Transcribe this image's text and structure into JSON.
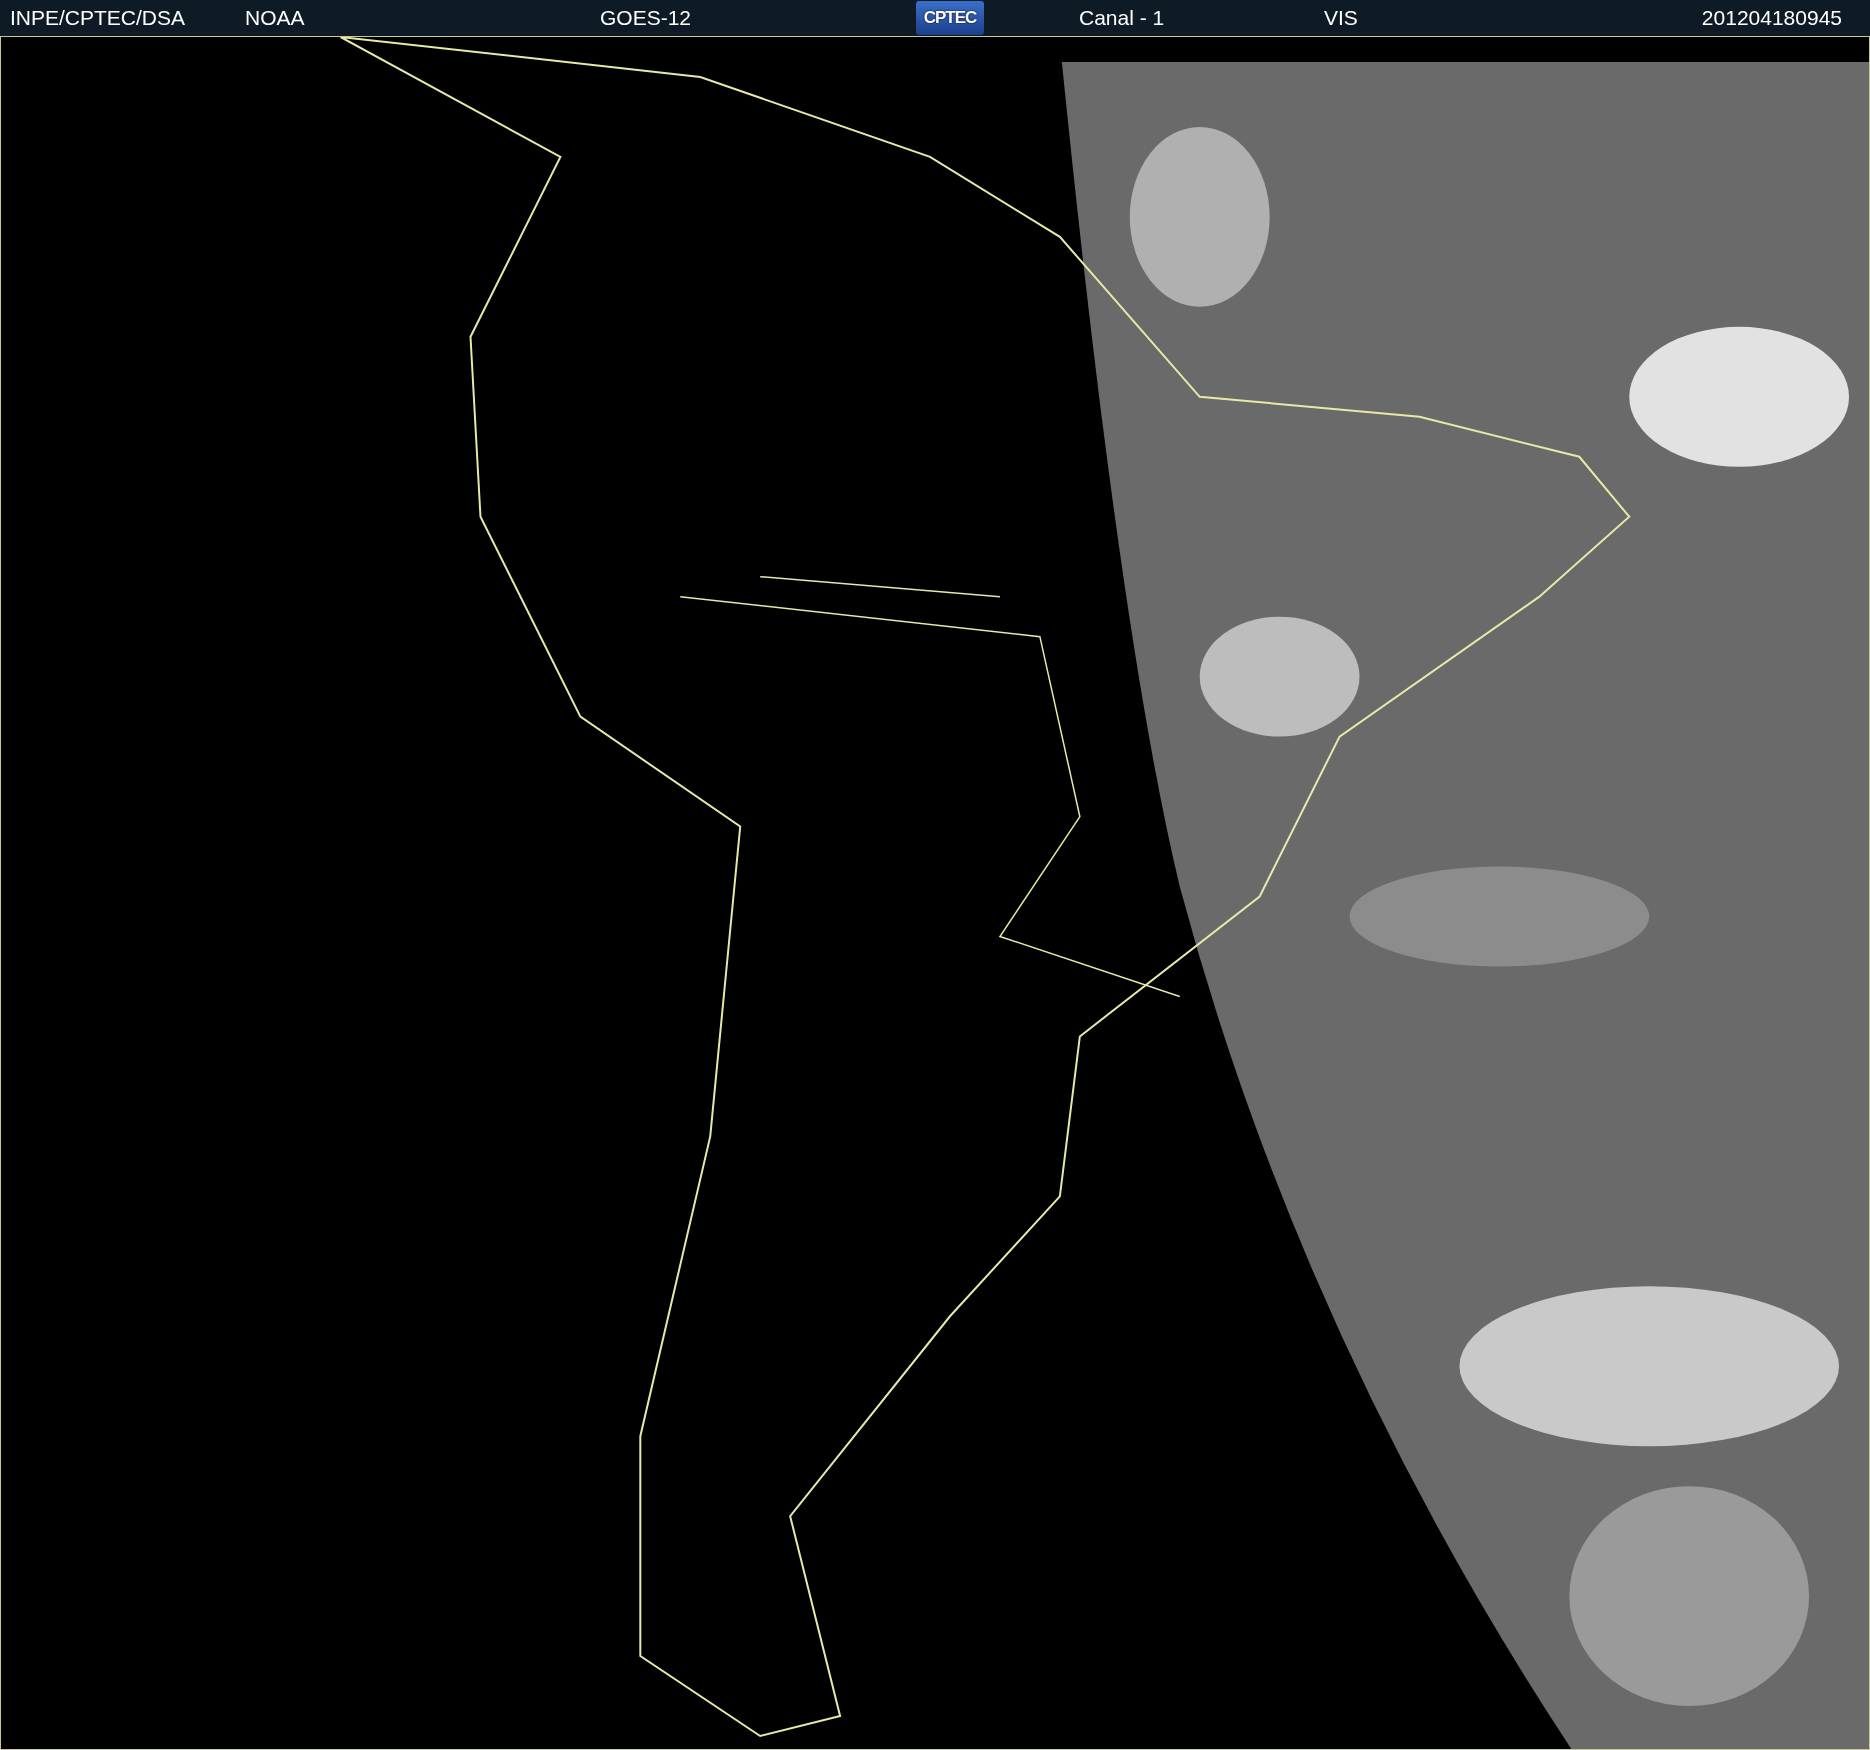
{
  "header": {
    "items": [
      {
        "kind": "text",
        "text": "INPE/CPTEC/DSA"
      },
      {
        "kind": "text",
        "text": "NOAA"
      },
      {
        "kind": "text",
        "text": "GOES-12"
      },
      {
        "kind": "logo",
        "text": "CPTEC"
      },
      {
        "kind": "text",
        "text": "Canal - 1"
      },
      {
        "kind": "text",
        "text": "VIS"
      },
      {
        "kind": "text",
        "text": "201204180945"
      }
    ]
  }
}
